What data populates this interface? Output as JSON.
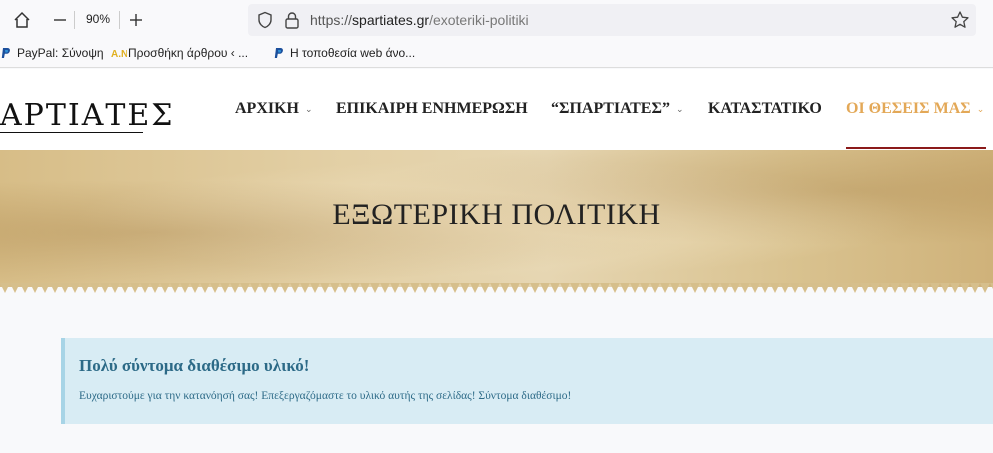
{
  "browser": {
    "zoom": "90%",
    "url_scheme": "https://",
    "url_domain": "spartiates.gr",
    "url_path": "/exoteriki-politiki"
  },
  "bookmarks": [
    {
      "label": "PayPal: Σύνοψη",
      "icon": "paypal-icon"
    },
    {
      "label": "Προσθήκη άρθρου ‹ ...",
      "icon": "an-icon"
    },
    {
      "label": "Η τοποθεσία web άνο...",
      "icon": "paypal-icon"
    }
  ],
  "site": {
    "logo": "ΑΡΤΙΑΤΕΣ",
    "nav": [
      {
        "label": "ΑΡΧΙΚΗ",
        "dropdown": true
      },
      {
        "label": "ΕΠΙΚΑΙΡΗ ΕΝΗΜΕΡΩΣΗ",
        "dropdown": false
      },
      {
        "label": "“ΣΠΑΡΤΙΑΤΕΣ”",
        "dropdown": true
      },
      {
        "label": "ΚΑΤΑΣΤΑΤΙΚΟ",
        "dropdown": false
      },
      {
        "label": "ΟΙ ΘΕΣΕΙΣ ΜΑΣ",
        "dropdown": true,
        "active": true
      }
    ],
    "active_color": "#e3a857",
    "accent_line_color": "#8b1a1a"
  },
  "banner": {
    "title": "ΕΞΩΤΕΡΙΚΗ ΠΟΛΙΤΙΚΗ"
  },
  "notice": {
    "title": "Πολύ σύντομα διαθέσιμο υλικό!",
    "text": "Ευχαριστούμε για την κατανόησή σας! Επεξεργαζόμαστε το υλικό αυτής της σελίδας! Σύντομα διαθέσιμο!"
  }
}
